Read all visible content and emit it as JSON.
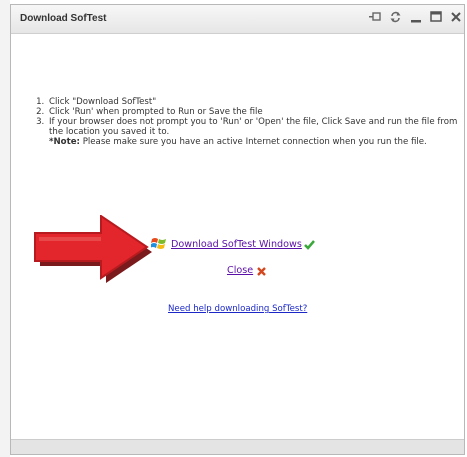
{
  "window": {
    "title": "Download SofTest",
    "controls": [
      "pin-icon",
      "refresh-icon",
      "minimize-icon",
      "maximize-icon",
      "close-icon"
    ]
  },
  "instructions": {
    "step1": "Click \"Download SofTest\"",
    "step2": "Click 'Run' when prompted to Run or Save the file",
    "step3": "If your browser does not prompt you to 'Run' or 'Open' the file, Click Save and run the file from the location you saved it to.",
    "note_label": "*Note:",
    "note_text": " Please make sure you have an active Internet connection when you run the file."
  },
  "links": {
    "download": "Download SofTest Windows",
    "close": "Close",
    "help": "Need help downloading SofTest?"
  },
  "colors": {
    "visited_link": "#5a0fa7",
    "help_link": "#1b28c7",
    "arrow_red": "#e3262b"
  }
}
